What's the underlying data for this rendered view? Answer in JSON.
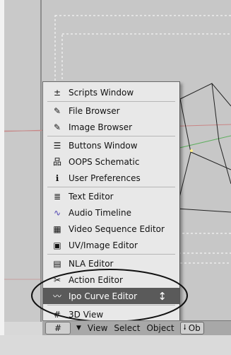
{
  "menu": {
    "items": [
      {
        "label": "Scripts Window",
        "icon": "plus-minus-icon",
        "glyph": "±"
      },
      {
        "label": "File Browser",
        "icon": "file-browser-icon",
        "glyph": "✎"
      },
      {
        "label": "Image Browser",
        "icon": "image-browser-icon",
        "glyph": "✎"
      },
      {
        "label": "Buttons Window",
        "icon": "buttons-window-icon",
        "glyph": "☰"
      },
      {
        "label": "OOPS Schematic",
        "icon": "oops-schematic-icon",
        "glyph": "品"
      },
      {
        "label": "User Preferences",
        "icon": "user-preferences-icon",
        "glyph": "ℹ"
      },
      {
        "label": "Text Editor",
        "icon": "text-editor-icon",
        "glyph": "≣"
      },
      {
        "label": "Audio Timeline",
        "icon": "audio-timeline-icon",
        "glyph": "∿"
      },
      {
        "label": "Video Sequence Editor",
        "icon": "video-sequence-icon",
        "glyph": "▦"
      },
      {
        "label": "UV/Image Editor",
        "icon": "uv-image-editor-icon",
        "glyph": "▣"
      },
      {
        "label": "NLA Editor",
        "icon": "nla-editor-icon",
        "glyph": "▤"
      },
      {
        "label": "Action Editor",
        "icon": "action-editor-icon",
        "glyph": "✂"
      },
      {
        "label": "Ipo Curve Editor",
        "icon": "ipo-curve-icon",
        "glyph": "〰"
      },
      {
        "label": "3D View",
        "icon": "3d-view-icon",
        "glyph": "#"
      }
    ],
    "selected": "Ipo Curve Editor",
    "cursor_glyph": "↕"
  },
  "header": {
    "editor_glyph": "#",
    "view_arrow": "▼",
    "view": "View",
    "select": "Select",
    "object": "Object",
    "object_btn_glyph": "⭭",
    "object_btn_label": "Ob"
  }
}
